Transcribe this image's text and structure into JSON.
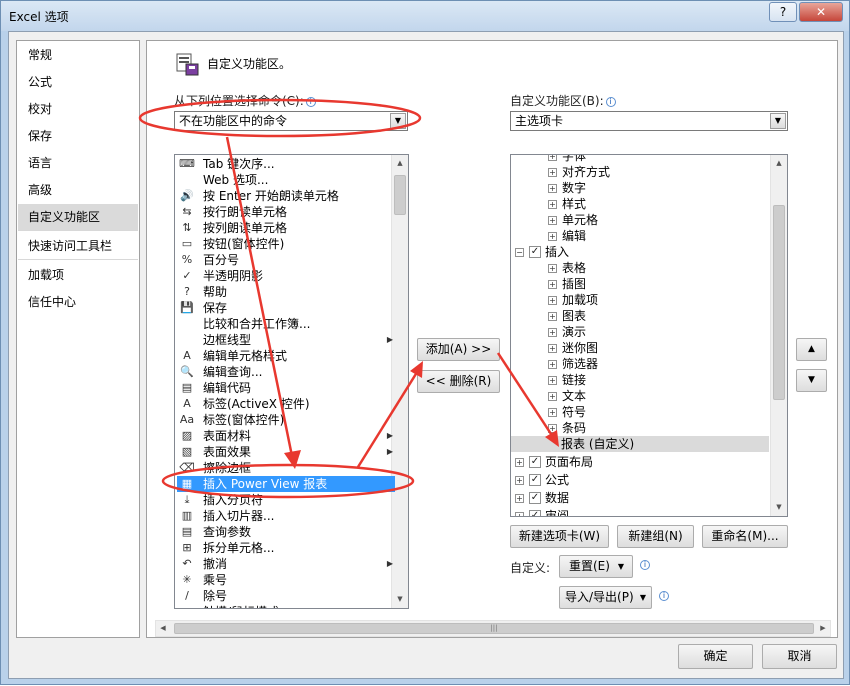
{
  "window": {
    "title": "Excel 选项",
    "help_label": "?",
    "close_label": "✕"
  },
  "nav": {
    "items": [
      {
        "label": "常规"
      },
      {
        "label": "公式"
      },
      {
        "label": "校对"
      },
      {
        "label": "保存"
      },
      {
        "label": "语言"
      },
      {
        "label": "高级"
      },
      {
        "label": "自定义功能区",
        "active": true
      },
      {
        "label": "快速访问工具栏"
      },
      {
        "label": "加载项"
      },
      {
        "label": "信任中心"
      }
    ]
  },
  "header": {
    "title": "自定义功能区。",
    "icon": "customize-ribbon-icon"
  },
  "left": {
    "source_label": "从下列位置选择命令(C):",
    "source_value": "不在功能区中的命令",
    "commands": [
      {
        "icon": "⌨",
        "label": "Tab 键次序..."
      },
      {
        "icon": "",
        "label": "Web 选项..."
      },
      {
        "icon": "🔊",
        "label": "按 Enter 开始朗读单元格"
      },
      {
        "icon": "⇆",
        "label": "按行朗读单元格"
      },
      {
        "icon": "⇅",
        "label": "按列朗读单元格"
      },
      {
        "icon": "▭",
        "label": "按钮(窗体控件)"
      },
      {
        "icon": "%",
        "label": "百分号"
      },
      {
        "icon": "✓",
        "label": "半透明阴影"
      },
      {
        "icon": "?",
        "label": "帮助"
      },
      {
        "icon": "💾",
        "label": "保存"
      },
      {
        "icon": "",
        "label": "比较和合并工作簿..."
      },
      {
        "icon": "",
        "label": "边框线型",
        "submenu": true
      },
      {
        "icon": "A",
        "label": "编辑单元格样式"
      },
      {
        "icon": "🔍",
        "label": "编辑查询..."
      },
      {
        "icon": "▤",
        "label": "编辑代码"
      },
      {
        "icon": "A",
        "label": "标签(ActiveX 控件)"
      },
      {
        "icon": "Aa",
        "label": "标签(窗体控件)"
      },
      {
        "icon": "▨",
        "label": "表面材料",
        "submenu": true
      },
      {
        "icon": "▧",
        "label": "表面效果",
        "submenu": true
      },
      {
        "icon": "⌫",
        "label": "擦除边框"
      },
      {
        "icon": "▦",
        "label": "插入 Power View 报表",
        "selected": true
      },
      {
        "icon": "⤓",
        "label": "插入分页符"
      },
      {
        "icon": "▥",
        "label": "插入切片器..."
      },
      {
        "icon": "▤",
        "label": "查询参数"
      },
      {
        "icon": "⊞",
        "label": "拆分单元格..."
      },
      {
        "icon": "↶",
        "label": "撤消",
        "submenu": true
      },
      {
        "icon": "✳",
        "label": "乘号"
      },
      {
        "icon": "/",
        "label": "除号"
      },
      {
        "icon": "",
        "label": "触摸/鼠标模式"
      }
    ]
  },
  "middle": {
    "add_label": "添加(A) >>",
    "remove_label": "<< 删除(R)"
  },
  "right": {
    "customize_label": "自定义功能区(B):",
    "customize_value": "主选项卡",
    "tree": [
      {
        "level": 2,
        "exp": "+",
        "label": "字体"
      },
      {
        "level": 2,
        "exp": "+",
        "label": "对齐方式"
      },
      {
        "level": 2,
        "exp": "+",
        "label": "数字"
      },
      {
        "level": 2,
        "exp": "+",
        "label": "样式"
      },
      {
        "level": 2,
        "exp": "+",
        "label": "单元格"
      },
      {
        "level": 2,
        "exp": "+",
        "label": "编辑"
      },
      {
        "level": 1,
        "exp": "−",
        "check": true,
        "label": "插入"
      },
      {
        "level": 2,
        "exp": "+",
        "label": "表格"
      },
      {
        "level": 2,
        "exp": "+",
        "label": "插图"
      },
      {
        "level": 2,
        "exp": "+",
        "label": "加载项"
      },
      {
        "level": 2,
        "exp": "+",
        "label": "图表"
      },
      {
        "level": 2,
        "exp": "+",
        "label": "演示"
      },
      {
        "level": 2,
        "exp": "+",
        "label": "迷你图"
      },
      {
        "level": 2,
        "exp": "+",
        "label": "筛选器"
      },
      {
        "level": 2,
        "exp": "+",
        "label": "链接"
      },
      {
        "level": 2,
        "exp": "+",
        "label": "文本"
      },
      {
        "level": 2,
        "exp": "+",
        "label": "符号"
      },
      {
        "level": 2,
        "exp": "+",
        "label": "条码"
      },
      {
        "level": 3,
        "exp": "",
        "label": "报表 (自定义)",
        "selected": true
      },
      {
        "level": 1,
        "exp": "+",
        "check": true,
        "label": "页面布局"
      },
      {
        "level": 1,
        "exp": "+",
        "check": true,
        "label": "公式"
      },
      {
        "level": 1,
        "exp": "+",
        "check": true,
        "label": "数据"
      },
      {
        "level": 1,
        "exp": "+",
        "check": true,
        "label": "审阅"
      }
    ],
    "new_tab_label": "新建选项卡(W)",
    "new_group_label": "新建组(N)",
    "rename_label": "重命名(M)...",
    "custom_label": "自定义:",
    "reset_label": "重置(E)",
    "import_export_label": "导入/导出(P)"
  },
  "updown": {
    "up": "▲",
    "down": "▼"
  },
  "footer": {
    "ok_label": "确定",
    "cancel_label": "取消"
  },
  "accent": "#3399ff",
  "annotation_color": "#e8382f"
}
